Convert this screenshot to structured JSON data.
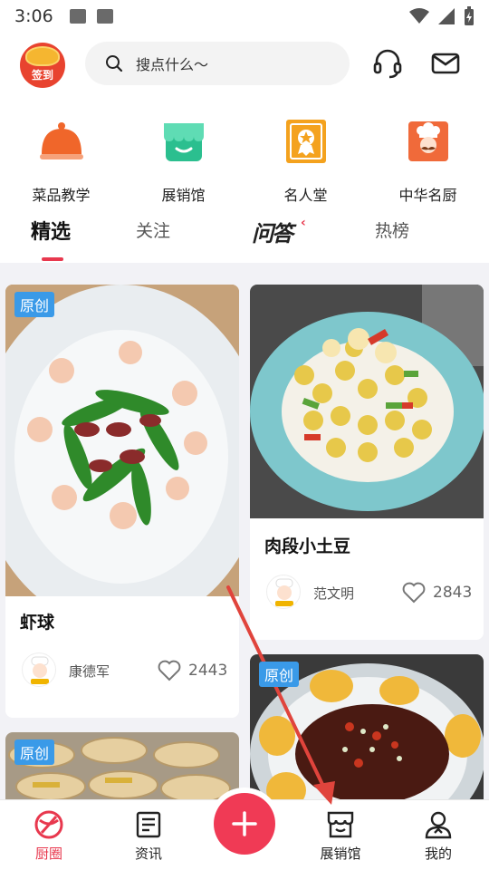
{
  "status_bar": {
    "time": "3:06"
  },
  "header": {
    "checkin_label": "签到",
    "search_placeholder": "搜点什么～",
    "icons": [
      "headset-icon",
      "mail-icon"
    ]
  },
  "categories": [
    {
      "label": "菜品教学",
      "icon": "cloche-icon",
      "color": "#f0662a"
    },
    {
      "label": "展销馆",
      "icon": "storefront-icon",
      "color": "#2bbf8f"
    },
    {
      "label": "名人堂",
      "icon": "award-certificate-icon",
      "color": "#f4a21e"
    },
    {
      "label": "中华名厨",
      "icon": "chef-portrait-icon",
      "color": "#f06a3a"
    }
  ],
  "tabs": [
    {
      "label": "精选",
      "active": true
    },
    {
      "label": "关注",
      "active": false
    },
    {
      "label": "问答",
      "active": false
    },
    {
      "label": "热榜",
      "active": false
    }
  ],
  "feed": {
    "badge_label": "原创",
    "cards": [
      {
        "title": "虾球",
        "author": "康德军",
        "likes": "2443",
        "badge": true
      },
      {
        "title": "肉段小土豆",
        "author": "范文明",
        "likes": "2843",
        "badge": false
      },
      {
        "title": "",
        "author": "",
        "likes": "",
        "badge": true
      },
      {
        "title": "",
        "author": "",
        "likes": "",
        "badge": true
      }
    ]
  },
  "bottom_nav": [
    {
      "label": "厨圈",
      "icon": "chef-circle-icon",
      "active": true
    },
    {
      "label": "资讯",
      "icon": "news-icon",
      "active": false
    },
    {
      "label": "展销馆",
      "icon": "storefront-icon",
      "active": false
    },
    {
      "label": "我的",
      "icon": "profile-icon",
      "active": false
    }
  ],
  "colors": {
    "accent": "#e8384e",
    "badge": "#3a9ae8",
    "annotation_arrow": "#e0443c"
  }
}
